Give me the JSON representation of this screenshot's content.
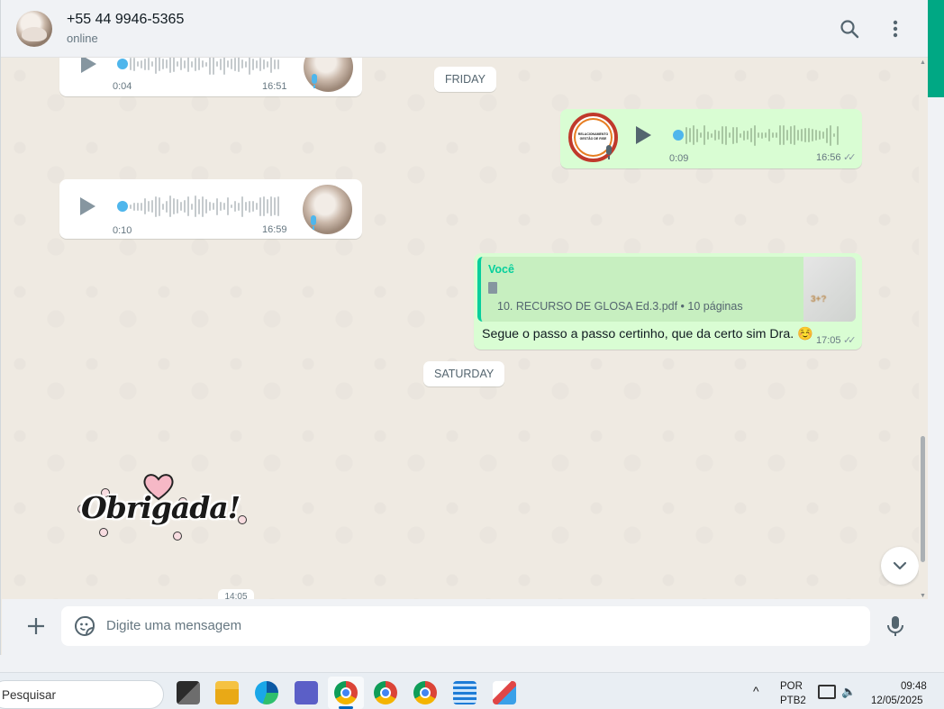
{
  "header": {
    "contact_name": "+55 44 9946-5365",
    "status": "online",
    "icons": [
      "search-icon",
      "menu-kebab-icon"
    ]
  },
  "chat": {
    "date_separators": {
      "friday": "FRIDAY",
      "saturday": "SATURDAY"
    },
    "voice_messages": [
      {
        "direction": "incoming",
        "duration": "0:04",
        "time": "16:51"
      },
      {
        "direction": "outgoing",
        "duration": "0:09",
        "time": "16:56",
        "read": true
      },
      {
        "direction": "incoming",
        "duration": "0:10",
        "time": "16:59"
      }
    ],
    "document_reply": {
      "author": "Você",
      "document_name": "10.  RECURSO DE GLOSA Ed.3.pdf • 10 páginas",
      "text": "Segue o passo a passo certinho, que da certo sim Dra. ☺️",
      "time": "17:05",
      "read": true
    },
    "sticker": {
      "text": "Obrigada!"
    },
    "partial_time": "14:05"
  },
  "composer": {
    "placeholder": "Digite uma mensagem",
    "icons": [
      "plus-icon",
      "sticker-icon",
      "microphone-icon"
    ]
  },
  "taskbar": {
    "search_placeholder": "Pesquisar",
    "language": "POR",
    "keyboard": "PTB2",
    "time": "09:48",
    "date": "12/05/2025"
  },
  "colors": {
    "accent": "#00a884",
    "outgoing_bubble": "#d9fdd3",
    "incoming_bubble": "#ffffff",
    "chat_bg": "#efeae2",
    "voice_dot": "#4fb6ec"
  }
}
